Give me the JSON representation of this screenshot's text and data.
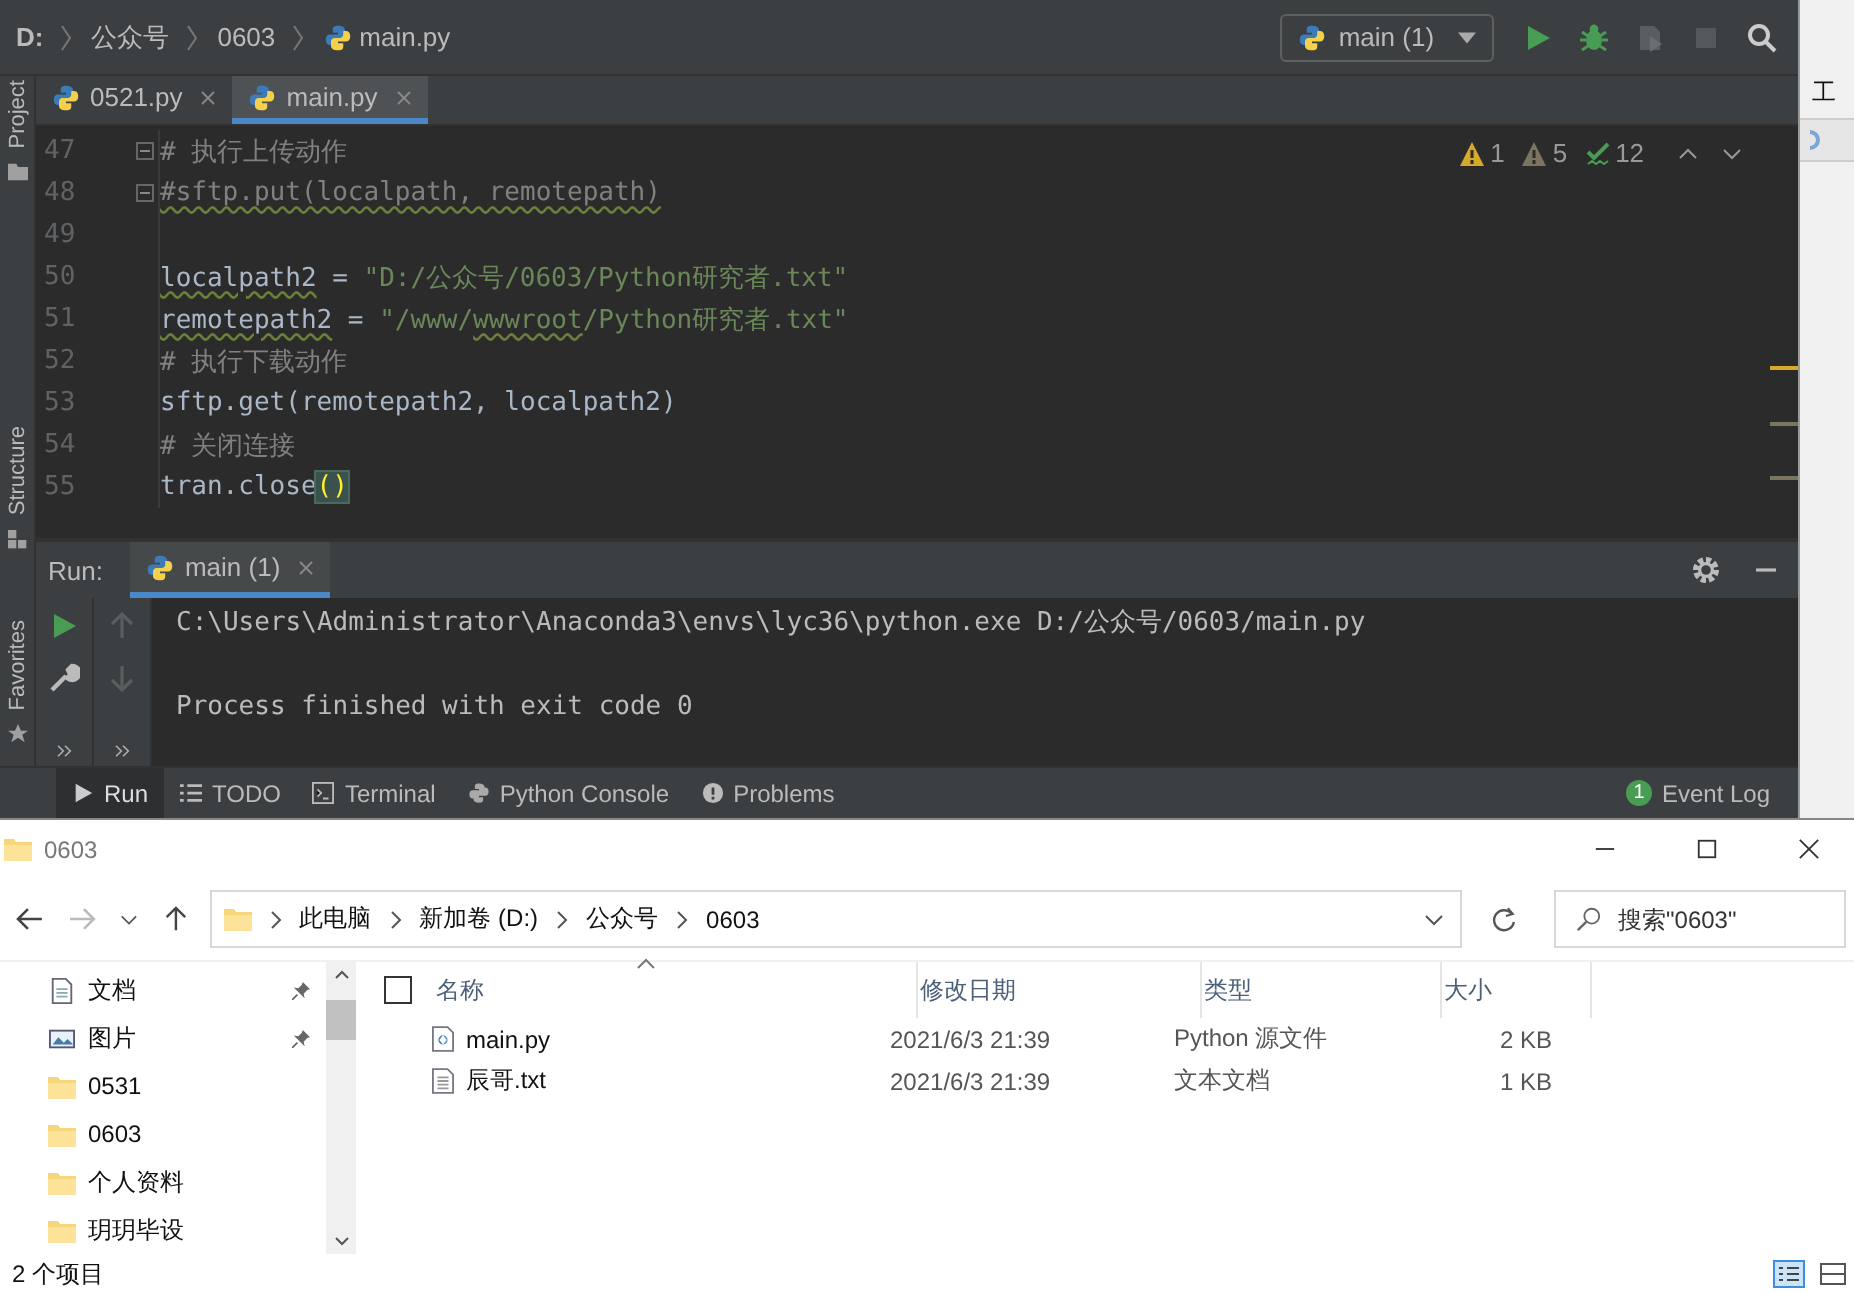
{
  "ide": {
    "breadcrumbs": [
      "D:",
      "公众号",
      "0603",
      "main.py"
    ],
    "run_config": "main (1)",
    "side_tools": [
      "Project",
      "Structure",
      "Favorites"
    ],
    "tabs": [
      {
        "label": "0521.py",
        "selected": false
      },
      {
        "label": "main.py",
        "selected": true
      }
    ],
    "inspections": [
      {
        "kind": "warning",
        "count": "1"
      },
      {
        "kind": "weak-warning",
        "count": "5"
      },
      {
        "kind": "typo",
        "count": "12"
      }
    ],
    "lines": [
      {
        "no": "47",
        "fold": true,
        "tokens": [
          {
            "kind": "comment",
            "text": "# 执行上传动作"
          }
        ]
      },
      {
        "no": "48",
        "fold": true,
        "tokens": [
          {
            "kind": "comment",
            "text": "#sftp.put(localpath, remotepath)",
            "underline": true
          }
        ]
      },
      {
        "no": "49",
        "fold": false
      },
      {
        "no": "50",
        "fold": false,
        "tokens": [
          {
            "kind": "plain",
            "text": "localpath2",
            "underline": true
          },
          {
            "kind": "plain",
            "text": " = "
          },
          {
            "kind": "string",
            "text": "\"D:/公众号/0603/Python研究者.txt\""
          }
        ]
      },
      {
        "no": "51",
        "fold": false,
        "tokens": [
          {
            "kind": "plain",
            "text": "remotepath2",
            "underline": true
          },
          {
            "kind": "plain",
            "text": " = "
          },
          {
            "kind": "string",
            "text": "\"/www/"
          },
          {
            "kind": "string",
            "text": "wwwroot",
            "underline": true
          },
          {
            "kind": "string",
            "text": "/Python研究者.txt\""
          }
        ]
      },
      {
        "no": "52",
        "fold": false,
        "tokens": [
          {
            "kind": "comment",
            "text": "# 执行下载动作"
          }
        ]
      },
      {
        "no": "53",
        "fold": false,
        "tokens": [
          {
            "kind": "plain",
            "text": "sftp.get(remotepath2, localpath2)"
          }
        ]
      },
      {
        "no": "54",
        "fold": false,
        "tokens": [
          {
            "kind": "comment",
            "text": "# 关闭连接"
          }
        ]
      },
      {
        "no": "55",
        "fold": false,
        "tokens": [
          {
            "kind": "plain",
            "text": "tran.close"
          },
          {
            "kind": "match",
            "text": "()"
          }
        ]
      }
    ],
    "run_label": "Run:",
    "run_tab": "main (1)",
    "output": [
      "C:\\Users\\Administrator\\Anaconda3\\envs\\lyc36\\python.exe D:/公众号/0603/main.py",
      "Process finished with exit code 0"
    ],
    "tool_windows": [
      {
        "kind": "run",
        "label": "Run",
        "selected": true
      },
      {
        "kind": "todo",
        "label": "TODO",
        "selected": false
      },
      {
        "kind": "terminal",
        "label": "Terminal",
        "selected": false
      },
      {
        "kind": "console",
        "label": "Python Console",
        "selected": false
      },
      {
        "kind": "problems",
        "label": "Problems",
        "selected": false
      }
    ],
    "event_log": {
      "label": "Event Log",
      "badge": "1"
    }
  },
  "side_window": {
    "text": "工"
  },
  "explorer": {
    "title": "0603",
    "address": [
      "此电脑",
      "新加卷 (D:)",
      "公众号",
      "0603"
    ],
    "search": {
      "placeholder": "搜索\"0603\""
    },
    "nav": [
      {
        "kind": "doc",
        "label": "文档",
        "pinned": true
      },
      {
        "kind": "picture",
        "label": "图片",
        "pinned": true
      },
      {
        "kind": "folder",
        "label": "0531",
        "pinned": false
      },
      {
        "kind": "folder",
        "label": "0603",
        "pinned": false
      },
      {
        "kind": "folder",
        "label": "个人资料",
        "pinned": false
      },
      {
        "kind": "folder",
        "label": "玥玥毕设",
        "pinned": false
      }
    ],
    "select_all": {
      "checked": false
    },
    "columns": [
      "名称",
      "修改日期",
      "类型",
      "大小"
    ],
    "files": [
      {
        "kind": "python",
        "name": "main.py",
        "modified": "2021/6/3 21:39",
        "type": "Python 源文件",
        "size": "2 KB"
      },
      {
        "kind": "text",
        "name": "辰哥.txt",
        "modified": "2021/6/3 21:39",
        "type": "文本文档",
        "size": "1 KB"
      }
    ],
    "status": "2 个项目"
  }
}
